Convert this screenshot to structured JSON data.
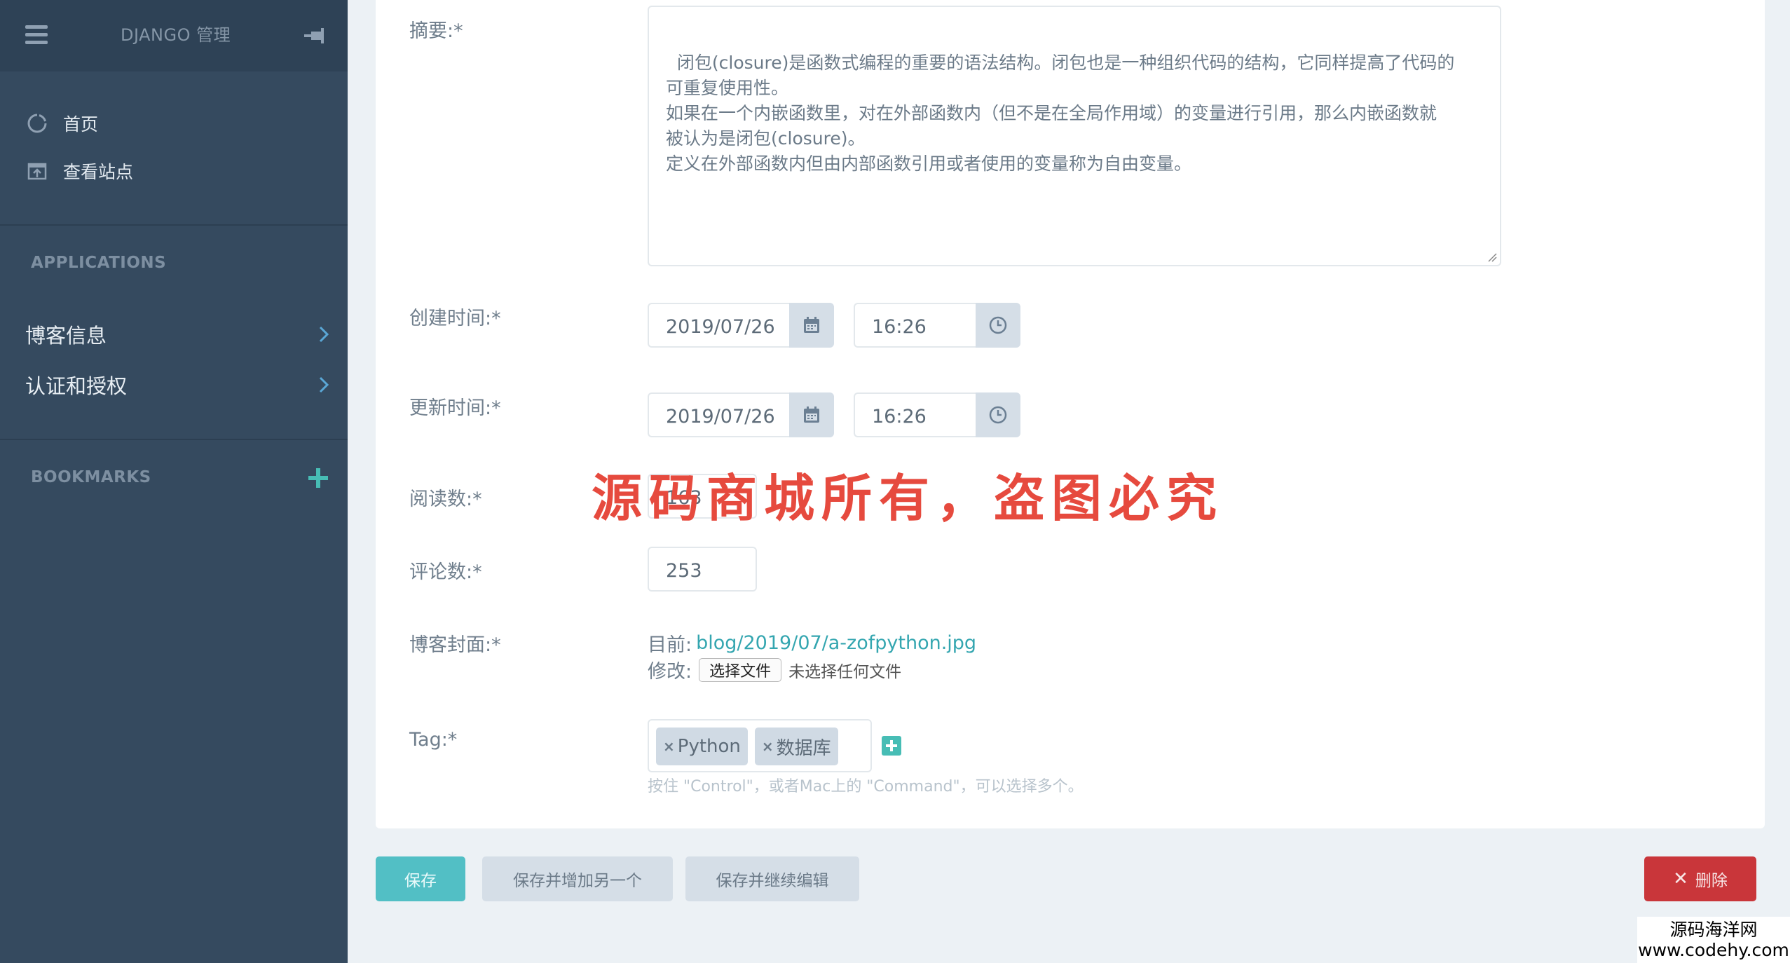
{
  "sidebar": {
    "title": "DJANGO 管理",
    "nav": [
      {
        "label": "首页"
      },
      {
        "label": "查看站点"
      }
    ],
    "applications_heading": "APPLICATIONS",
    "apps": [
      {
        "label": "博客信息"
      },
      {
        "label": "认证和授权"
      }
    ],
    "bookmarks_heading": "BOOKMARKS"
  },
  "form": {
    "summary": {
      "label": "摘要:*",
      "value": "闭包(closure)是函数式编程的重要的语法结构。闭包也是一种组织代码的结构，它同样提高了代码的\n可重复使用性。\n如果在一个内嵌函数里，对在外部函数内（但不是在全局作用域）的变量进行引用，那么内嵌函数就\n被认为是闭包(closure)。\n定义在外部函数内但由内部函数引用或者使用的变量称为自由变量。"
    },
    "created": {
      "label": "创建时间:*",
      "date": "2019/07/26",
      "time": "16:26"
    },
    "updated": {
      "label": "更新时间:*",
      "date": "2019/07/26",
      "time": "16:26"
    },
    "reads": {
      "label": "阅读数:*",
      "value": "163"
    },
    "comments": {
      "label": "评论数:*",
      "value": "253"
    },
    "cover": {
      "label": "博客封面:*",
      "current_prefix": "目前:",
      "current_link": "blog/2019/07/a-zofpython.jpg",
      "change_prefix": "修改:",
      "choose_button": "选择文件",
      "no_file": "未选择任何文件"
    },
    "tags": {
      "label": "Tag:*",
      "selected": [
        "Python",
        "数据库"
      ],
      "help": "按住 \"Control\"，或者Mac上的 \"Command\"，可以选择多个。"
    }
  },
  "buttons": {
    "save": "保存",
    "save_add": "保存并增加另一个",
    "save_continue": "保存并继续编辑",
    "delete": "删除"
  },
  "watermark": {
    "center": "源码商城所有，盗图必究",
    "corner_line1": "源码海洋网",
    "corner_line2": "www.codehy.com"
  },
  "colors": {
    "sidebar": "#354a5f",
    "accent": "#52bfc5",
    "delete": "#c9363a",
    "link": "#34a6b0"
  }
}
